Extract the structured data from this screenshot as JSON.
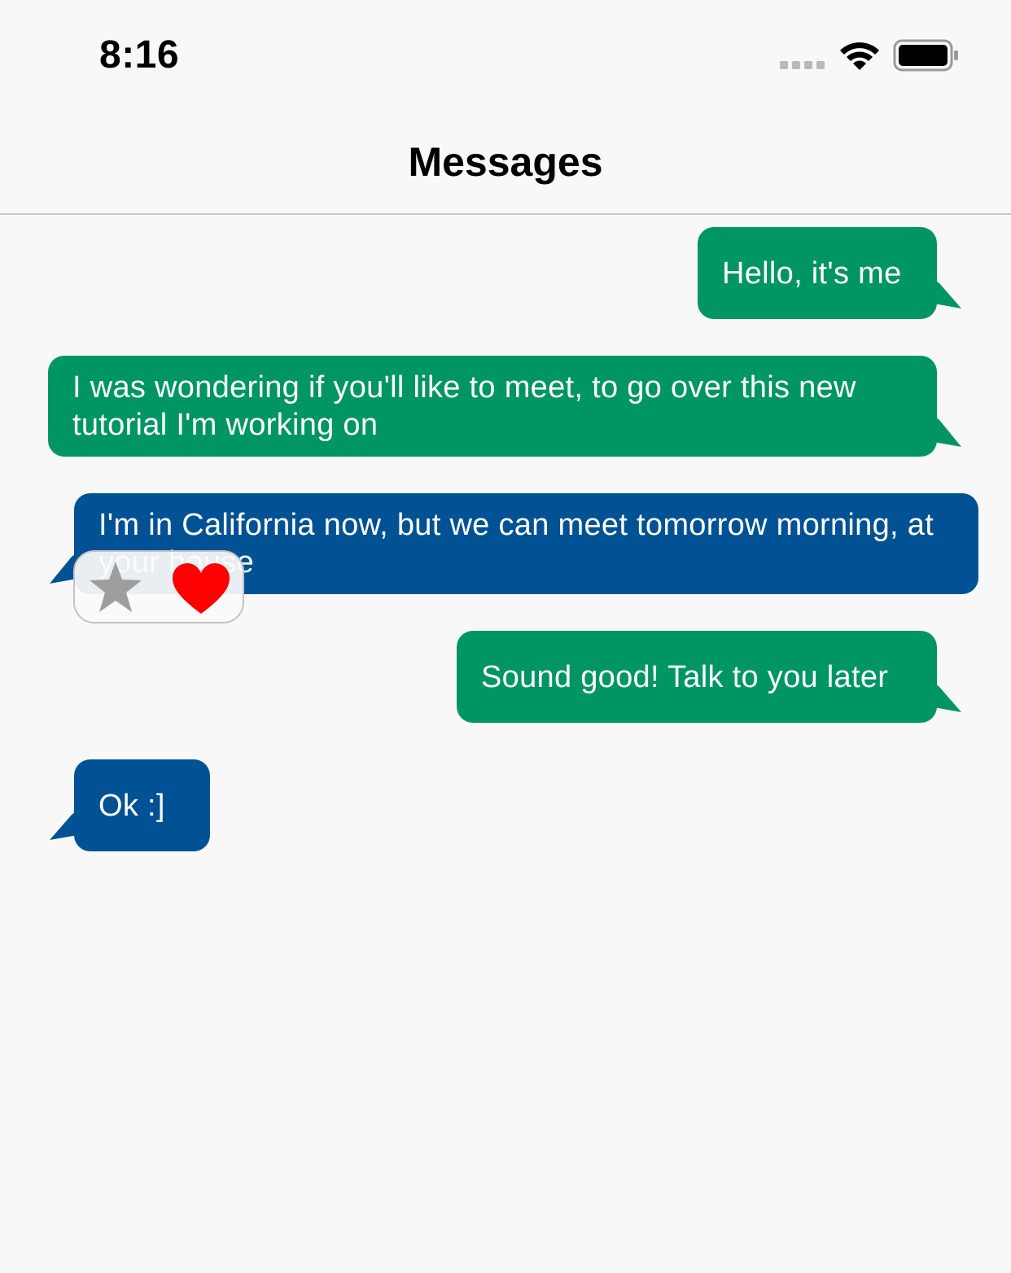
{
  "status_bar": {
    "time": "8:16"
  },
  "nav": {
    "title": "Messages"
  },
  "messages": [
    {
      "sender": "me",
      "text": "Hello, it's me"
    },
    {
      "sender": "me",
      "text": "I was wondering if you'll like to meet, to go over this new tutorial I'm working on"
    },
    {
      "sender": "other",
      "text": "I'm in California now, but we can meet tomorrow morning, at your house",
      "reactions": [
        "star-icon",
        "heart-icon"
      ]
    },
    {
      "sender": "me",
      "text": "Sound good! Talk to you later"
    },
    {
      "sender": "other",
      "text": "Ok :]"
    }
  ],
  "colors": {
    "outgoing_bubble": "#009664",
    "incoming_bubble": "#005294",
    "background": "#f8f8f8",
    "star": "#9e9e9e",
    "heart": "#ff0000"
  }
}
